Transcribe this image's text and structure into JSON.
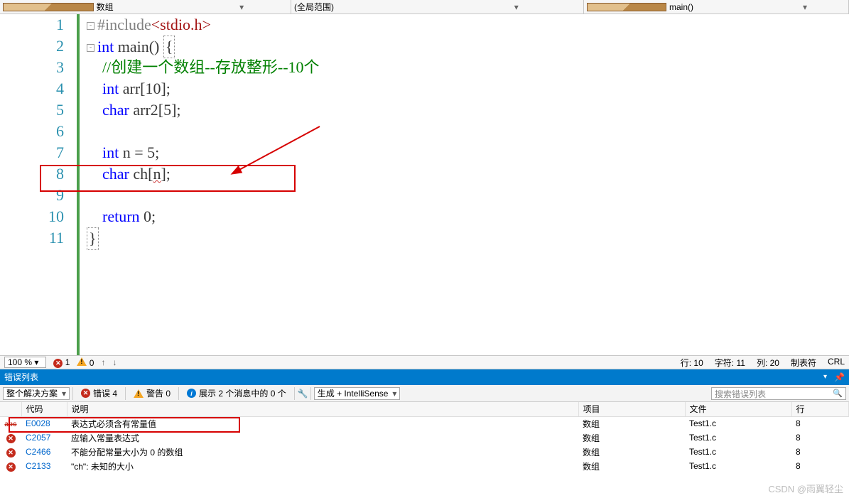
{
  "topbar": {
    "combo1": "数组",
    "combo2": "(全局范围)",
    "combo3": "main()"
  },
  "code": {
    "lines": [
      "1",
      "2",
      "3",
      "4",
      "5",
      "6",
      "7",
      "8",
      "9",
      "10",
      "11"
    ],
    "l1_a": "#include",
    "l1_b": "<stdio.h>",
    "l2_a": "int",
    "l2_b": " main() ",
    "l2_c": "{",
    "l3": "//创建一个数组--存放整形--10个",
    "l4_a": "int",
    "l4_b": " arr",
    "l4_c": "[10];",
    "l5_a": "char",
    "l5_b": " arr2",
    "l5_c": "[5];",
    "l7_a": "int",
    "l7_b": " n = 5;",
    "l8_a": "char",
    "l8_b": " ch[",
    "l8_c": "n",
    "l8_d": "];",
    "l10_a": "return",
    "l10_b": " 0;",
    "l11": "}"
  },
  "edstat": {
    "zoom": "100 %",
    "err": "1",
    "warn": "0",
    "line_lbl": "行: 10",
    "char_lbl": "字符: 11",
    "col_lbl": "列: 20",
    "tab_lbl": "制表符",
    "crlf": "CRL"
  },
  "errpanel": {
    "title": "错误列表",
    "scope": "整个解决方案",
    "btn_err": "错误 4",
    "btn_warn": "警告 0",
    "btn_msg": "展示 2 个消息中的 0 个",
    "build": "生成 + IntelliSense",
    "search_ph": "搜索错误列表",
    "cols": {
      "code": "代码",
      "desc": "说明",
      "proj": "项目",
      "file": "文件",
      "line": "行"
    },
    "rows": [
      {
        "ico": "abc",
        "code": "E0028",
        "desc": "表达式必须含有常量值",
        "proj": "数组",
        "file": "Test1.c",
        "line": "8"
      },
      {
        "ico": "err",
        "code": "C2057",
        "desc": "应输入常量表达式",
        "proj": "数组",
        "file": "Test1.c",
        "line": "8"
      },
      {
        "ico": "err",
        "code": "C2466",
        "desc": "不能分配常量大小为 0 的数组",
        "proj": "数组",
        "file": "Test1.c",
        "line": "8"
      },
      {
        "ico": "err",
        "code": "C2133",
        "desc": "\"ch\": 未知的大小",
        "proj": "数组",
        "file": "Test1.c",
        "line": "8"
      }
    ]
  },
  "watermark": "CSDN @雨翼轻尘"
}
